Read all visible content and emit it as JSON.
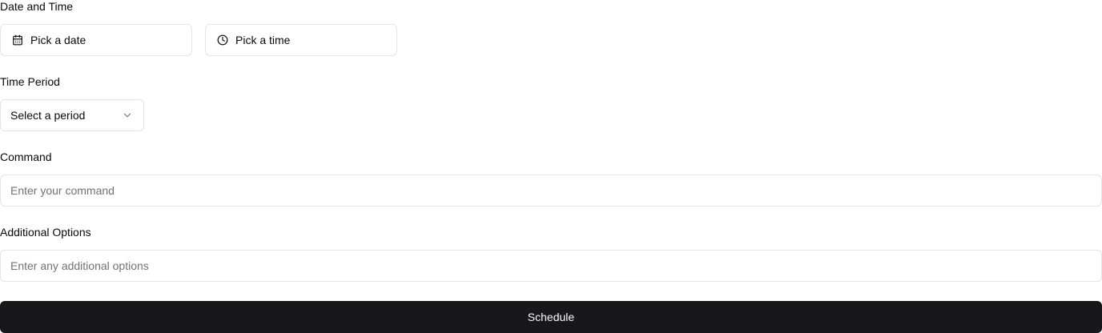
{
  "date_time": {
    "label": "Date and Time",
    "date_picker": {
      "text": "Pick a date",
      "icon": "calendar-icon"
    },
    "time_picker": {
      "text": "Pick a time",
      "icon": "clock-icon"
    }
  },
  "time_period": {
    "label": "Time Period",
    "select": {
      "text": "Select a period",
      "icon": "chevron-down-icon"
    }
  },
  "command": {
    "label": "Command",
    "placeholder": "Enter your command",
    "value": ""
  },
  "additional_options": {
    "label": "Additional Options",
    "placeholder": "Enter any additional options",
    "value": ""
  },
  "submit": {
    "label": "Schedule"
  },
  "colors": {
    "primary": "#18181b",
    "primary_text": "#fafafa",
    "border": "#e4e4e7",
    "muted_text": "#71717a",
    "text": "#09090b"
  }
}
